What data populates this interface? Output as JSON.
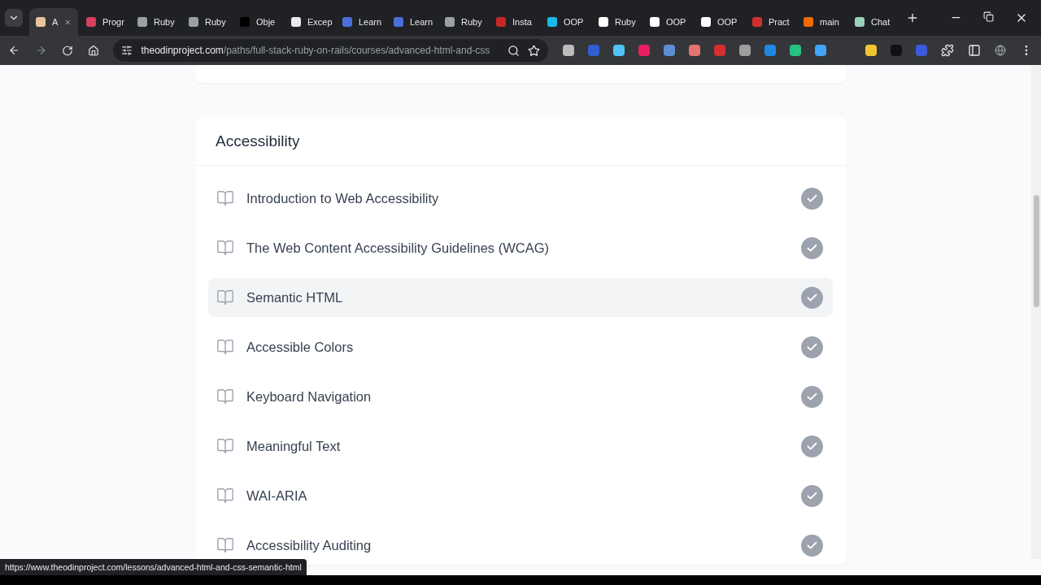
{
  "browser": {
    "tabs": [
      {
        "title": "A",
        "selected": true
      },
      {
        "title": "Progr",
        "selected": false
      },
      {
        "title": "Ruby",
        "selected": false
      },
      {
        "title": "Ruby",
        "selected": false
      },
      {
        "title": "Obje",
        "selected": false
      },
      {
        "title": "Excep",
        "selected": false
      },
      {
        "title": "Learn",
        "selected": false
      },
      {
        "title": "Learn",
        "selected": false
      },
      {
        "title": "Ruby",
        "selected": false
      },
      {
        "title": "Insta",
        "selected": false
      },
      {
        "title": "OOP",
        "selected": false
      },
      {
        "title": "Ruby",
        "selected": false
      },
      {
        "title": "OOP",
        "selected": false
      },
      {
        "title": "OOP",
        "selected": false
      },
      {
        "title": "Pract",
        "selected": false
      },
      {
        "title": "main",
        "selected": false
      },
      {
        "title": "Chat",
        "selected": false
      }
    ],
    "address": {
      "host": "theodinproject.com",
      "path": "/paths/full-stack-ruby-on-rails/courses/advanced-html-and-css"
    },
    "status_url": "https://www.theodinproject.com/lessons/advanced-html-and-css-semantic-html"
  },
  "section": {
    "title": "Accessibility",
    "lessons": [
      {
        "title": "Introduction to Web Accessibility",
        "completed": true,
        "hovered": false
      },
      {
        "title": "The Web Content Accessibility Guidelines (WCAG)",
        "completed": true,
        "hovered": false
      },
      {
        "title": "Semantic HTML",
        "completed": true,
        "hovered": true
      },
      {
        "title": "Accessible Colors",
        "completed": true,
        "hovered": false
      },
      {
        "title": "Keyboard Navigation",
        "completed": true,
        "hovered": false
      },
      {
        "title": "Meaningful Text",
        "completed": true,
        "hovered": false
      },
      {
        "title": "WAI-ARIA",
        "completed": true,
        "hovered": false
      },
      {
        "title": "Accessibility Auditing",
        "completed": true,
        "hovered": false
      }
    ]
  }
}
